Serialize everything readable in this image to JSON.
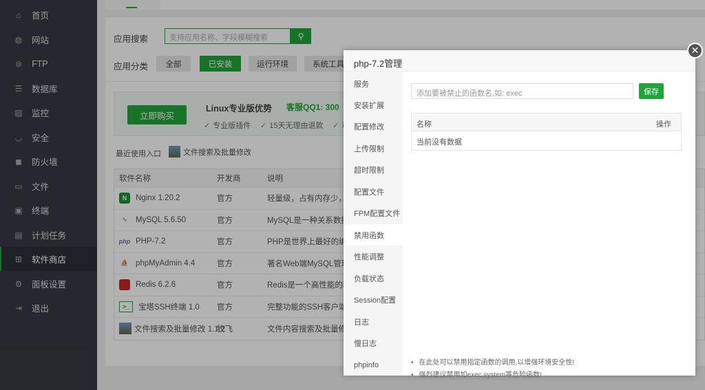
{
  "sidebar": {
    "items": [
      {
        "label": "首页",
        "icon": "home-icon"
      },
      {
        "label": "网站",
        "icon": "globe-icon"
      },
      {
        "label": "FTP",
        "icon": "ftp-icon"
      },
      {
        "label": "数据库",
        "icon": "database-icon"
      },
      {
        "label": "监控",
        "icon": "monitor-icon"
      },
      {
        "label": "安全",
        "icon": "shield-icon"
      },
      {
        "label": "防火墙",
        "icon": "firewall-icon"
      },
      {
        "label": "文件",
        "icon": "folder-icon"
      },
      {
        "label": "终端",
        "icon": "terminal-icon"
      },
      {
        "label": "计划任务",
        "icon": "calendar-icon"
      },
      {
        "label": "软件商店",
        "icon": "apps-icon",
        "active": true
      },
      {
        "label": "面板设置",
        "icon": "gear-icon"
      },
      {
        "label": "退出",
        "icon": "logout-icon"
      }
    ]
  },
  "store": {
    "search_label": "应用搜索",
    "search_placeholder": "支持应用名称、字段模糊搜索",
    "category_label": "应用分类",
    "categories": [
      "全部",
      "已安装",
      "运行环境",
      "系统工具"
    ],
    "promo": {
      "buy": "立即购买",
      "title": "Linux专业版优势",
      "qq": "客服QQ1: 300",
      "features": [
        "专业版插件",
        "15天无理由退款",
        "可"
      ]
    },
    "recent_label": "最近使用入口",
    "recent_item": "文件搜索及批量修改",
    "headers": [
      "软件名称",
      "开发商",
      "说明"
    ],
    "rows": [
      {
        "name": "Nginx 1.20.2",
        "dev": "官方",
        "desc": "轻量级，占有内存少，并发"
      },
      {
        "name": "MySQL 5.6.50",
        "dev": "官方",
        "desc": "MySQL是一种关系数据库管"
      },
      {
        "name": "PHP-7.2",
        "dev": "官方",
        "desc": "PHP是世界上最好的编程语"
      },
      {
        "name": "phpMyAdmin 4.4",
        "dev": "官方",
        "desc": "著名Web端MySQL管理工具"
      },
      {
        "name": "Redis 6.2.6",
        "dev": "官方",
        "desc": "Redis是一个高性能的key-v"
      },
      {
        "name": "宝塔SSH终端 1.0",
        "dev": "官方",
        "desc": "完整功能的SSH客户端，仅"
      },
      {
        "name": "文件搜索及批量修改 1.1.2",
        "dev": "牧飞",
        "desc": "文件内容搜索及批量修改(可"
      }
    ]
  },
  "modal": {
    "title": "php-7.2管理",
    "nav": [
      "服务",
      "安装扩展",
      "配置修改",
      "上传限制",
      "超时限制",
      "配置文件",
      "FPM配置文件",
      "禁用函数",
      "性能调整",
      "负载状态",
      "Session配置",
      "日志",
      "慢日志",
      "phpinfo"
    ],
    "active": "禁用函数",
    "input_placeholder": "添加要被禁止的函数名,如: exec",
    "save": "保存",
    "col_name": "名称",
    "col_action": "操作",
    "empty": "当前没有数据",
    "notes": [
      "在此处可以禁用指定函数的调用,以增强环境安全性!",
      "强烈建议禁用如exec,system等危险函数!"
    ]
  }
}
